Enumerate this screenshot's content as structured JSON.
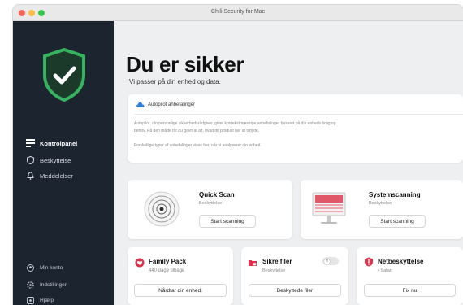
{
  "window": {
    "title": "Chili Security for Mac"
  },
  "sidebar": {
    "nav": [
      {
        "label": "Kontrolpanel",
        "icon": "dashboard-icon",
        "active": true
      },
      {
        "label": "Beskyttelse",
        "icon": "shield-outline-icon"
      },
      {
        "label": "Meddelelser",
        "icon": "bell-icon"
      }
    ],
    "bottom": [
      {
        "label": "Min konto",
        "icon": "account-icon"
      },
      {
        "label": "Indstillinger",
        "icon": "gear-icon"
      },
      {
        "label": "Hjælp",
        "icon": "help-icon"
      }
    ]
  },
  "main": {
    "headline": "Du er sikker",
    "subhead": "Vi passer på din enhed og data.",
    "recommendations": {
      "title": "Autopilot anbefalinger",
      "line1": "Autopilot, din personlige sikkerhedsrådgiver, giver kontekstmæssige anbefalinger baseret på din enheds brug og",
      "line2": "behov. På den måde får du gavn af alt, hvad dit produkt har at tilbyde.",
      "line3": "Forskellige typer af anbefalinger vises her, når vi analyserer din enhed."
    },
    "quick_scan": {
      "title": "Quick Scan",
      "sub": "Beskyttelse",
      "button": "Start scanning"
    },
    "system_scan": {
      "title": "Systemscanning",
      "sub": "Beskyttelse",
      "button": "Start scanning"
    },
    "family_pack": {
      "title": "Family Pack",
      "sub": "440 dage tilbage",
      "button": "Nårdtar din enhed."
    },
    "safe_files": {
      "title": "Sikre filer",
      "sub": "Beskyttelse",
      "button": "Beskyttede filer",
      "toggle_label": "✕"
    },
    "web_protection": {
      "title": "Netbeskyttelse",
      "sub": "• Safari",
      "button": "Fix nu"
    }
  },
  "colors": {
    "sidebar_bg": "#1c2430",
    "shield_green": "#2e9e53",
    "accent_red": "#e0314a"
  }
}
